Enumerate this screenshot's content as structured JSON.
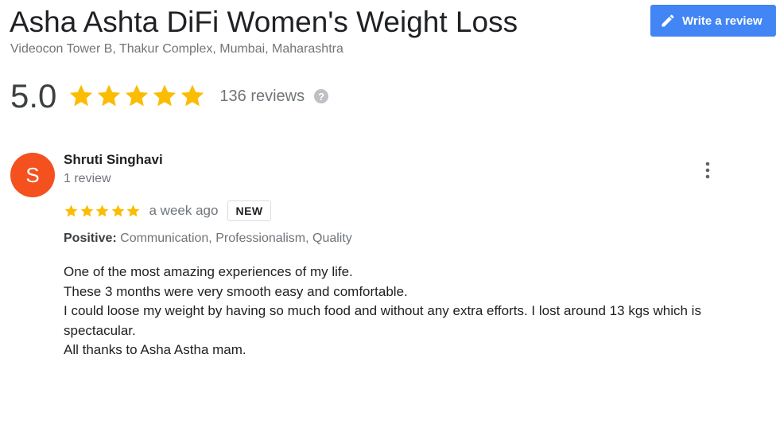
{
  "business": {
    "name": "Asha Ashta DiFi Women's Weight Loss",
    "address": "Videocon Tower B, Thakur Complex, Mumbai, Maharashtra"
  },
  "write_review": {
    "label": "Write a review",
    "icon": "pencil-icon",
    "color": "#4285f4"
  },
  "rating": {
    "value": "5.0",
    "stars": 5,
    "review_count": "136 reviews",
    "help_icon": "help-icon",
    "star_color": "#fbbc04"
  },
  "review": {
    "author": {
      "initial": "S",
      "name": "Shruti Singhavi",
      "reviews": "1 review",
      "avatar_color": "#f4511e"
    },
    "stars": 5,
    "time_ago": "a week ago",
    "badge": "NEW",
    "positive_label": "Positive:",
    "positive_values": "Communication, Professionalism, Quality",
    "text_lines": [
      "One of the most amazing experiences of my life.",
      "These 3 months were very smooth easy and comfortable.",
      "I could loose my weight by having so much food and without any extra efforts. I lost around 13 kgs which is spectacular.",
      "All thanks to Asha Astha mam."
    ],
    "more_icon": "more-vert-icon"
  }
}
